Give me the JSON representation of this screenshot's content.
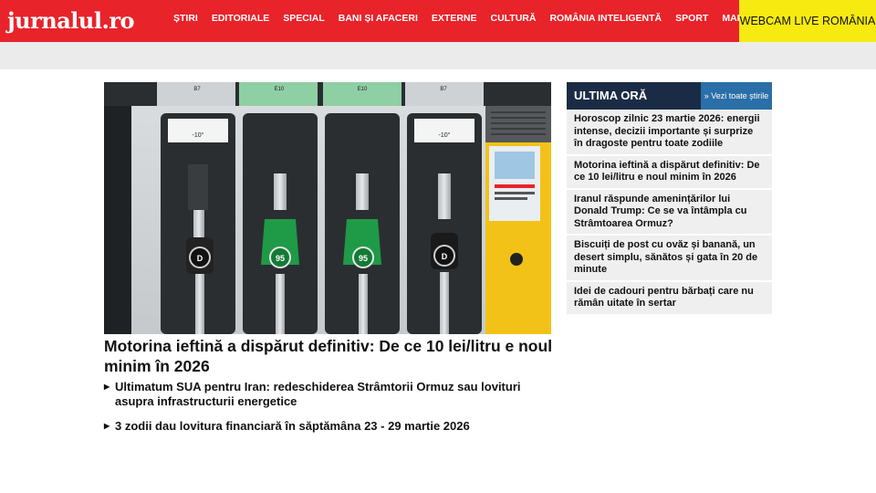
{
  "header": {
    "logo": "jurnalul.ro",
    "nav": [
      "ȘTIRI",
      "EDITORIALE",
      "SPECIAL",
      "BANI ȘI AFACERI",
      "EXTERNE",
      "CULTURĂ",
      "ROMÂNIA INTELIGENTĂ",
      "SPORT",
      "MAI MULTE"
    ],
    "webcam_label": "WEBCAM LIVE ROMÂNIA"
  },
  "hero": {
    "image_labels": {
      "fuel_grade_1": "B7",
      "fuel_grade_2": "E10",
      "fuel_grade_3": "E10",
      "fuel_grade_4": "B7",
      "discount_1": "-10°",
      "discount_2": "-10°",
      "nozzle_1": "D",
      "nozzle_2": "95",
      "nozzle_3": "95",
      "nozzle_4": "D"
    },
    "title": "Motorina ieftină a dispărut definitiv: De ce 10 lei/litru e noul minim în 2026",
    "related": [
      "Ultimatum SUA pentru Iran: redeschiderea Strâmtorii Ormuz sau lovituri asupra infrastructurii energetice",
      "3 zodii dau lovitura financiară în săptămâna 23 - 29 martie 2026"
    ]
  },
  "sidebar": {
    "title": "ULTIMA ORĂ",
    "more_label": "» Vezi toate știrile",
    "items": [
      "Horoscop zilnic 23 martie 2026: energii intense, decizii importante și surprize în dragoste pentru toate zodiile",
      "Motorina ieftină a dispărut definitiv: De ce 10 lei/litru e noul minim în 2026",
      "Iranul răspunde amenințărilor lui Donald Trump: Ce se va întâmpla cu Strâmtoarea Ormuz?",
      "Biscuiți de post cu ovăz și banană, un desert simplu, sănătos și gata în 20 de minute",
      "Idei de cadouri pentru bărbați care nu rămân uitate în sertar"
    ]
  },
  "colors": {
    "brand_red": "#e8232a",
    "webcam_yellow": "#f7ea10",
    "sidebar_navy": "#1a2c45",
    "sidebar_link_blue": "#2a6fa8"
  }
}
